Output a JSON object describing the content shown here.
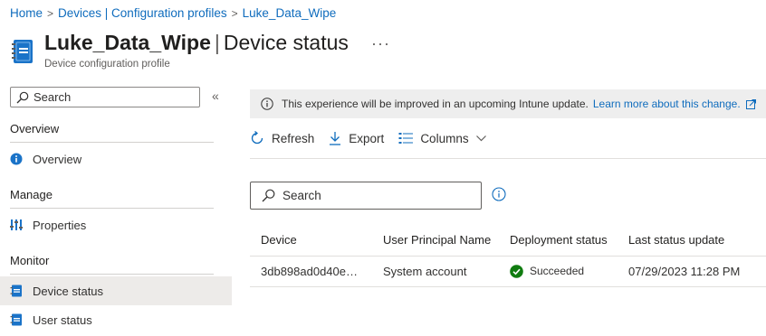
{
  "breadcrumb": {
    "items": [
      "Home",
      "Devices | Configuration profiles",
      "Luke_Data_Wipe"
    ],
    "separator": ">"
  },
  "header": {
    "title": "Luke_Data_Wipe",
    "separator": "|",
    "section": "Device status",
    "subtitle": "Device configuration profile",
    "more": "···"
  },
  "sidebar": {
    "search_placeholder": "Search",
    "collapse": "«",
    "sections": [
      {
        "heading": "Overview",
        "items": [
          {
            "label": "Overview",
            "icon": "info-icon"
          }
        ]
      },
      {
        "heading": "Manage",
        "items": [
          {
            "label": "Properties",
            "icon": "properties-icon"
          }
        ]
      },
      {
        "heading": "Monitor",
        "items": [
          {
            "label": "Device status",
            "icon": "device-status-icon",
            "active": true
          },
          {
            "label": "User status",
            "icon": "user-status-icon"
          }
        ]
      }
    ]
  },
  "banner": {
    "message": "This experience will be improved in an upcoming Intune update.",
    "link": "Learn more about this change.",
    "background": "#eeeeee"
  },
  "toolbar": {
    "refresh": "Refresh",
    "export": "Export",
    "columns": "Columns"
  },
  "main_search": {
    "placeholder": "Search"
  },
  "table": {
    "columns": [
      "Device",
      "User Principal Name",
      "Deployment status",
      "Last status update"
    ],
    "rows": [
      {
        "device": "3db898ad0d40e…",
        "upn": "System account",
        "status": "Succeeded",
        "last_update": "07/29/2023 11:28 PM"
      }
    ]
  },
  "colors": {
    "link": "#0f6cbd",
    "success": "#107c10",
    "active_nav": "#edebe9"
  }
}
